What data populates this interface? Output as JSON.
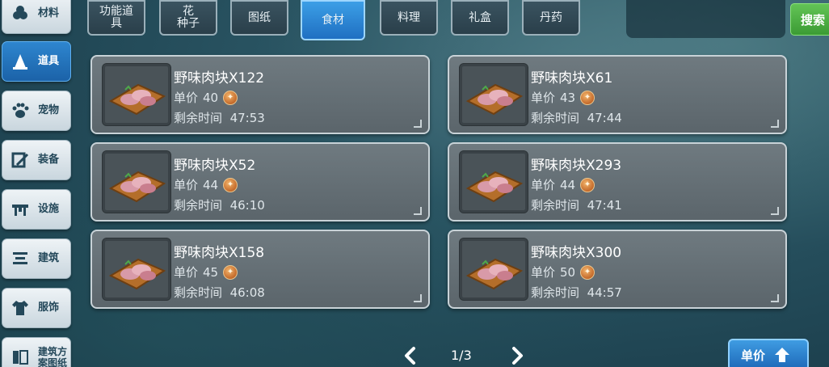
{
  "sidebar": {
    "items": [
      {
        "label": "材料",
        "icon": "materials-icon"
      },
      {
        "label": "道具",
        "icon": "item-icon"
      },
      {
        "label": "宠物",
        "icon": "paw-icon"
      },
      {
        "label": "装备",
        "icon": "equipment-icon"
      },
      {
        "label": "设施",
        "icon": "facility-icon"
      },
      {
        "label": "建筑",
        "icon": "building-icon"
      },
      {
        "label": "服饰",
        "icon": "clothing-icon"
      },
      {
        "label_line1": "建筑方",
        "label_line2": "案图纸",
        "icon": "blueprint-icon"
      }
    ],
    "active_index": 1
  },
  "tabs": [
    {
      "line1": "功能道",
      "line2": "具"
    },
    {
      "line1": "花",
      "line2": "种子"
    },
    {
      "label": "图纸"
    },
    {
      "label": "食材"
    },
    {
      "label": "料理"
    },
    {
      "label": "礼盒"
    },
    {
      "label": "丹药"
    }
  ],
  "active_tab": "食材",
  "search": {
    "button_label": "搜索",
    "value": ""
  },
  "listings": [
    {
      "name": "野味肉块X122",
      "price_label": "单价",
      "price": "40",
      "time_label": "剩余时间",
      "time": "47:53"
    },
    {
      "name": "野味肉块X61",
      "price_label": "单价",
      "price": "43",
      "time_label": "剩余时间",
      "time": "47:44"
    },
    {
      "name": "野味肉块X52",
      "price_label": "单价",
      "price": "44",
      "time_label": "剩余时间",
      "time": "46:10"
    },
    {
      "name": "野味肉块X293",
      "price_label": "单价",
      "price": "44",
      "time_label": "剩余时间",
      "time": "47:41"
    },
    {
      "name": "野味肉块X158",
      "price_label": "单价",
      "price": "45",
      "time_label": "剩余时间",
      "time": "46:08"
    },
    {
      "name": "野味肉块X300",
      "price_label": "单价",
      "price": "50",
      "time_label": "剩余时间",
      "time": "44:57"
    }
  ],
  "pagination": {
    "page": "1/3"
  },
  "sort": {
    "label": "单价",
    "icon": "sort-up-icon"
  },
  "colors": {
    "accent_blue": "#2e86cf",
    "search_green": "#4fb043",
    "coin": "#c46a2b"
  }
}
